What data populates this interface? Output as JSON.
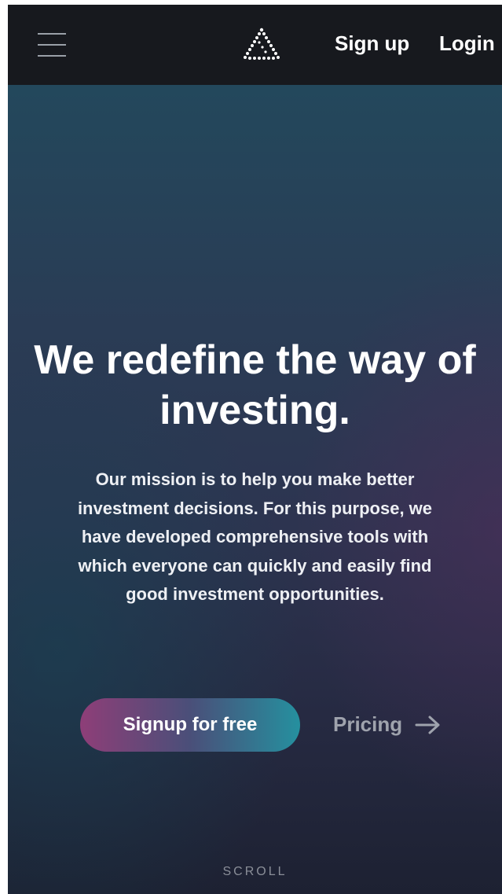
{
  "header": {
    "menu_icon": "hamburger-menu-icon",
    "logo_icon": "triangle-dots-logo-icon",
    "signup_label": "Sign up",
    "login_label": "Login"
  },
  "hero": {
    "title": "We redefine the way of investing.",
    "description": "Our mission is to help you make better investment decisions. For this purpose, we have developed comprehensive tools with which everyone can quickly and easily find good investment opportunities.",
    "cta_label": "Signup for free",
    "pricing_label": "Pricing",
    "pricing_icon": "arrow-right-icon",
    "scroll_label": "SCROLL"
  },
  "colors": {
    "topbar": "#17191e",
    "cta_gradient_start": "#8e3e78",
    "cta_gradient_end": "#25909f",
    "muted_text": "#9fa3ad"
  }
}
